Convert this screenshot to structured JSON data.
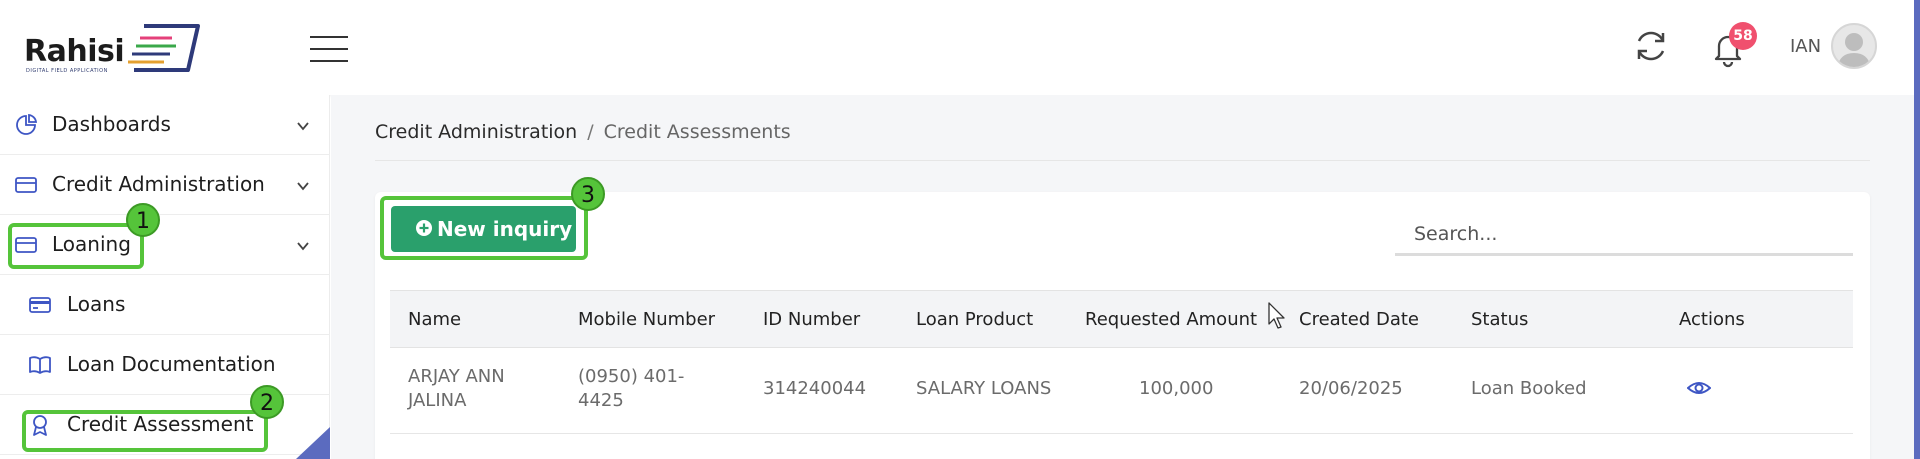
{
  "header": {
    "logo_text": "Rahisi",
    "logo_subtext": "DIGITAL FIELD APPLICATION",
    "notification_count": "58",
    "user_name": "IAN"
  },
  "sidebar": {
    "items": [
      {
        "label": "Dashboards",
        "icon": "pie-chart-icon"
      },
      {
        "label": "Credit Administration",
        "icon": "card-icon"
      },
      {
        "label": "Loaning",
        "icon": "card-icon"
      }
    ],
    "sub_items": [
      {
        "label": "Loans",
        "icon": "credit-card-icon"
      },
      {
        "label": "Loan Documentation",
        "icon": "book-icon"
      },
      {
        "label": "Credit Assessment",
        "icon": "award-icon"
      }
    ]
  },
  "callouts": [
    "1",
    "2",
    "3"
  ],
  "breadcrumb": {
    "parent": "Credit Administration",
    "separator": "/",
    "current": "Credit Assessments"
  },
  "toolbar": {
    "new_inquiry_label": "New inquiry",
    "search_placeholder": "Search..."
  },
  "table": {
    "columns": [
      "Name",
      "Mobile Number",
      "ID Number",
      "Loan Product",
      "Requested Amount",
      "Created Date",
      "Status",
      "Actions"
    ],
    "rows": [
      {
        "name_line1": "ARJAY ANN",
        "name_line2": "JALINA",
        "mobile_line1": "(0950) 401-",
        "mobile_line2": "4425",
        "id_number": "314240044",
        "loan_product": "SALARY LOANS",
        "requested_amount": "100,000",
        "created_date": "20/06/2025",
        "status": "Loan Booked",
        "action_icon": "eye-icon"
      }
    ]
  },
  "colors": {
    "accent_green": "#2aa06c",
    "callout_green": "#55c43a",
    "icon_blue": "#3e56c4",
    "badge_pink": "#f0506e"
  }
}
